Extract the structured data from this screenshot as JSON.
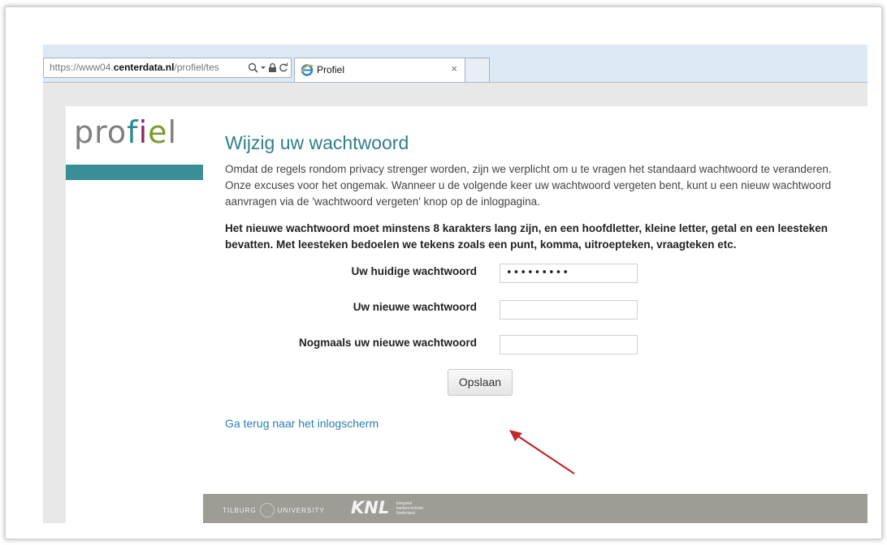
{
  "browser": {
    "address": {
      "scheme": "https://",
      "host_prefix": "www04.",
      "host_bold": "centerdata.nl",
      "path": "/profiel/tes",
      "icons": [
        "search-icon",
        "dropdown-arrow-icon",
        "lock-icon",
        "refresh-icon"
      ]
    },
    "tab": {
      "title": "Profiel",
      "close": "×",
      "icon": "ie-favicon-icon"
    }
  },
  "page": {
    "logo": {
      "p1": "pro",
      "f": "f",
      "i": "i",
      "e": "e",
      "l": "l"
    },
    "title": "Wijzig uw wachtwoord",
    "intro": "Omdat de regels rondom privacy strenger worden, zijn we verplicht om u te vragen het standaard wachtwoord te veranderen. Onze excuses voor het ongemak. Wanneer u de volgende keer uw wachtwoord vergeten bent, kunt u een nieuw wachtwoord aanvragen via de 'wachtwoord vergeten' knop op de inlogpagina.",
    "requirements": "Het nieuwe wachtwoord moet minstens 8 karakters lang zijn, en een hoofdletter, kleine letter, getal en een leesteken bevatten. Met leesteken bedoelen we tekens zoals een punt, komma, uitroepteken, vraagteken etc.",
    "form": {
      "current_label": "Uw huidige wachtwoord",
      "current_value": "•••••••••",
      "new_label": "Uw nieuwe wachtwoord",
      "new_value": "",
      "repeat_label": "Nogmaals uw nieuwe wachtwoord",
      "repeat_value": "",
      "save_label": "Opslaan"
    },
    "back_link": "Ga terug naar het inlogscherm",
    "footer": {
      "tilburg_left": "TILBURG",
      "tilburg_right": "UNIVERSITY",
      "knl": "KNL",
      "knl_sub1": "integraal",
      "knl_sub2": "kankercentrum",
      "knl_sub3": "Nederland"
    }
  },
  "colors": {
    "accent_teal": "#2f7f8a",
    "link_blue": "#2a7fb3",
    "annotation_arrow": "#c0282d",
    "footer_bg": "#9f9c96"
  }
}
